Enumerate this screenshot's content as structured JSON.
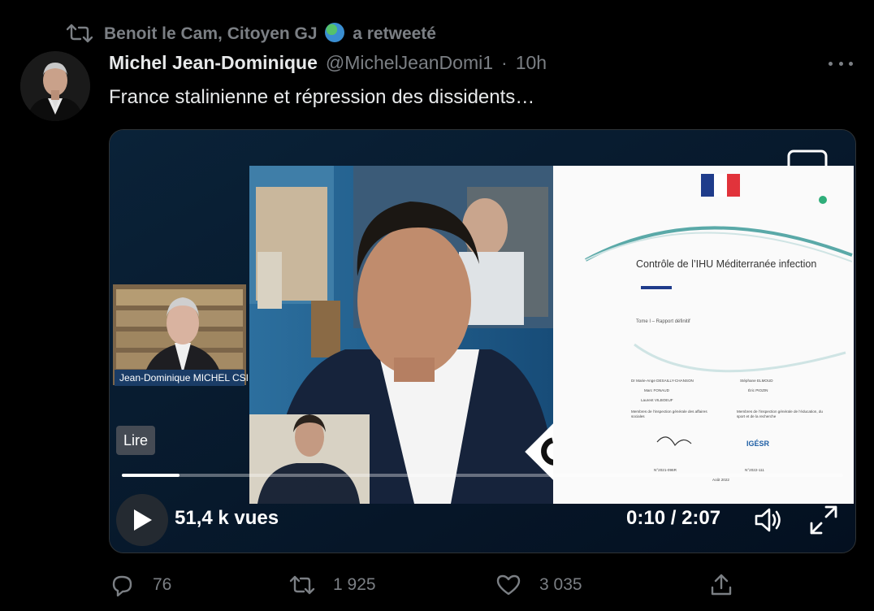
{
  "retweet": {
    "retweeter": "Benoit le Cam, Citoyen GJ",
    "action_text": "a retweeté",
    "icon": "retweet-icon",
    "emoji": "globe-icon"
  },
  "tweet": {
    "author_name": "Michel Jean-Dominique",
    "handle": "@MichelJeanDomi1",
    "separator": "·",
    "time": "10h",
    "text": "France stalinienne et répression des dissidents…",
    "more_icon": "more-icon"
  },
  "video": {
    "inset_caption": "Jean-Dominique MICHEL CSI",
    "document": {
      "title": "Contrôle de l’IHU Méditerranée infection",
      "subtitle": "Tome I – Rapport définitif",
      "col1_names": [
        "Dr Marie-Ange DESAILLY-CHANSON",
        "Marc FONAUD",
        "Laurent VILBOEUF"
      ],
      "col1_org": "Membres de l’inspection générale des affaires sociales",
      "col2_names": [
        "Stéphane ELMOUD",
        "Éric PIOZIN"
      ],
      "col2_org": "Membres de l’inspection générale de l’éducation, du sport et de la recherche",
      "ref1": "N°2021-096R",
      "ref2": "N°2022-111",
      "date": "Août 2022"
    },
    "channel_logo": "C",
    "lire_label": "Lire",
    "progress": 0.08,
    "views": "51,4 k vues",
    "current_time": "0:10",
    "time_separator": "/",
    "duration": "2:07",
    "play_icon": "play-icon",
    "volume_icon": "volume-icon",
    "fullscreen_icon": "fullscreen-icon"
  },
  "actions": {
    "replies": "76",
    "retweets": "1 925",
    "likes": "3 035",
    "reply_icon": "reply-icon",
    "retweet_icon": "retweet-icon",
    "like_icon": "heart-icon",
    "share_icon": "share-icon"
  }
}
